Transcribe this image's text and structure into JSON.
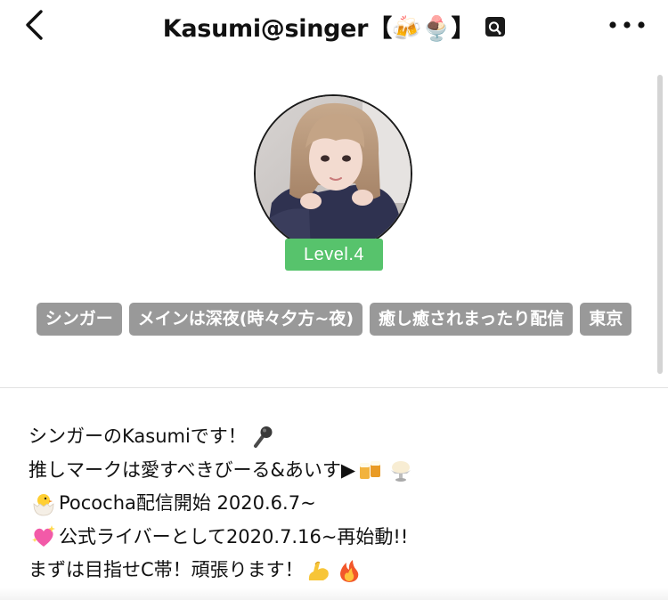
{
  "header": {
    "title": "Kasumi@singer【🍻🍨】",
    "back_icon": "chevron-left-icon",
    "search_icon": "user-search-icon",
    "more_icon": "more-horizontal-icon"
  },
  "profile": {
    "level": "Level.4",
    "level_color": "#57c36c",
    "tags": [
      "シンガー",
      "メインは深夜(時々夕方~夜)",
      "癒し癒されまったり配信",
      "東京"
    ],
    "tag_color": "#999999"
  },
  "bio": {
    "line1_text": "シンガーのKasumiです！",
    "line1_icon": "microphone-emoji",
    "line2_text": "推しマークは愛すべきびーる&あいす▶",
    "line2_icons": [
      "beer-mugs-emoji",
      "ice-cream-emoji"
    ],
    "line3_icon": "hatching-chick-emoji",
    "line3_text": "Pococha配信開始 2020.6.7~",
    "line4_icon": "sparkling-heart-emoji",
    "line4_text": "公式ライバーとして2020.7.16~再始動!!",
    "line5_text": "まずは目指せC帯！頑張ります！",
    "line5_icons": [
      "flexed-biceps-emoji",
      "fire-emoji"
    ]
  }
}
